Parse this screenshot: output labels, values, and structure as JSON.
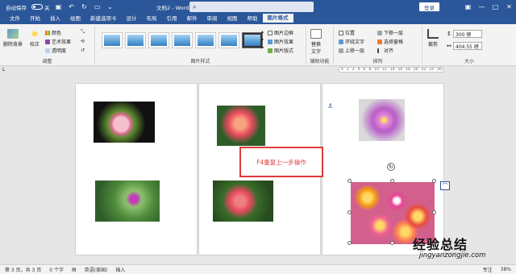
{
  "titlebar": {
    "autosave_label": "自动保存",
    "toggle_state": "关",
    "doc_title": "文档2 - Word",
    "search_icon": "search-icon",
    "login_label": "登录",
    "window_controls": [
      "—",
      "□",
      "✕"
    ]
  },
  "tabs": [
    "文件",
    "开始",
    "插入",
    "绘图",
    "新建选项卡",
    "设计",
    "布局",
    "引用",
    "邮件",
    "审阅",
    "视图",
    "帮助",
    "图片格式"
  ],
  "active_tab": "图片格式",
  "ribbon": {
    "adjust": {
      "remove_bg": "删除背景",
      "correct": "校正",
      "color": "颜色",
      "artistic": "艺术效果",
      "transparency": "透明度",
      "group_label": "调整"
    },
    "styles": {
      "border": "图片边框",
      "effects": "图片效果",
      "layout": "图片版式",
      "group_label": "图片样式"
    },
    "accessibility": {
      "alt_text": "替换文字",
      "group_label": "辅助功能"
    },
    "arrange": {
      "position": "位置",
      "wrap_text": "环绕文字",
      "bring_forward": "上移一层",
      "send_backward": "下移一层",
      "selection_pane": "选择窗格",
      "align": "对齐",
      "group_label": "排列"
    },
    "size": {
      "crop": "裁剪",
      "height": "300 磅",
      "width": "404.55 磅",
      "group_label": "大小"
    }
  },
  "annotation": "F4重复上一步操作",
  "statusbar": {
    "page": "第 3 页，共 3 页",
    "words": "0 个字",
    "language": "英语(美国)",
    "mode": "插入",
    "focus": "专注",
    "zoom": "38%"
  },
  "watermark": {
    "main": "经验总结",
    "sub": "jingyanzongjie.com"
  },
  "ruler_ticks": [
    "4",
    "2",
    "2",
    "4",
    "6",
    "8",
    "10",
    "12",
    "14",
    "16",
    "18",
    "20",
    "22",
    "24",
    "26",
    "28",
    "30",
    "32",
    "34",
    "36",
    "38",
    "40"
  ],
  "colors": {
    "accent": "#2b579a",
    "highlight": "#e03a3a"
  }
}
